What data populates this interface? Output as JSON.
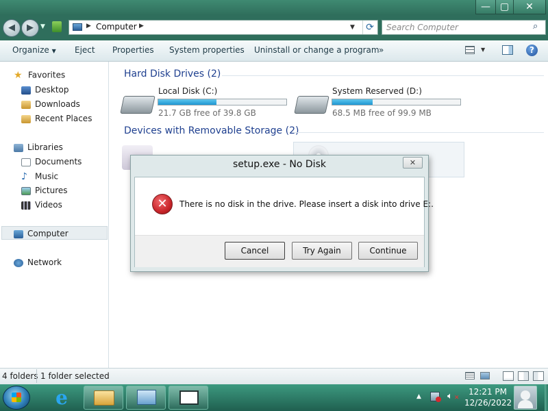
{
  "window": {
    "minimize_glyph": "—",
    "maximize_glyph": "▢",
    "close_glyph": "✕"
  },
  "address": {
    "crumb": "Computer",
    "search_placeholder": "Search Computer"
  },
  "toolbar": {
    "organize": "Organize",
    "eject": "Eject",
    "properties": "Properties",
    "system_properties": "System properties",
    "uninstall": "Uninstall or change a program",
    "more": "»"
  },
  "nav": {
    "favorites": "Favorites",
    "desktop": "Desktop",
    "downloads": "Downloads",
    "recent_places": "Recent Places",
    "libraries": "Libraries",
    "documents": "Documents",
    "music": "Music",
    "pictures": "Pictures",
    "videos": "Videos",
    "computer": "Computer",
    "network": "Network"
  },
  "content": {
    "hard_disk_heading": "Hard Disk Drives (2)",
    "removable_heading": "Devices with Removable Storage (2)",
    "drives": [
      {
        "name": "Local Disk (C:)",
        "free": "21.7 GB free of 39.8 GB",
        "used_fraction": 0.455
      },
      {
        "name": "System Reserved (D:)",
        "free": "68.5 MB free of 99.9 MB",
        "used_fraction": 0.314
      }
    ]
  },
  "dialog": {
    "title": "setup.exe - No Disk",
    "message": "There is no disk in the drive. Please insert a disk into drive E:.",
    "cancel": "Cancel",
    "try_again": "Try Again",
    "continue": "Continue",
    "close_glyph": "✕"
  },
  "status": {
    "folders": "4 folders",
    "selected": "1 folder selected"
  },
  "taskbar": {
    "time": "12:21 PM",
    "date": "12/26/2022"
  },
  "colors": {
    "accent": "#2f6e5c",
    "heading_blue": "#1e3f8f",
    "drive_fill": "#1e96d2",
    "error_red": "#c9262b"
  }
}
